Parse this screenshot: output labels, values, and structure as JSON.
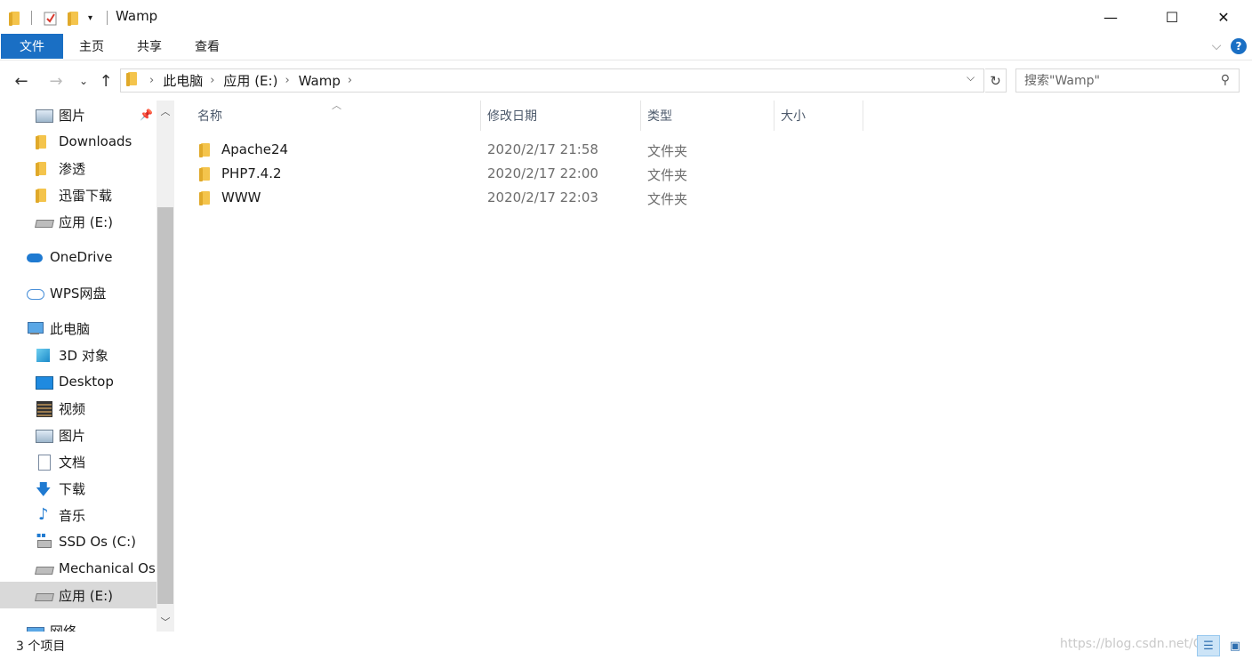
{
  "window": {
    "title": "Wamp",
    "minimize": "—",
    "maximize": "☐",
    "close": "✕"
  },
  "ribbon": {
    "tabs": [
      "文件",
      "主页",
      "共享",
      "查看"
    ],
    "collapse": "⌵",
    "help": "?"
  },
  "nav_buttons": {
    "back": "←",
    "forward": "→",
    "recent": "⌄",
    "up": "↑"
  },
  "address": {
    "crumbs": [
      "此电脑",
      "应用 (E:)",
      "Wamp"
    ],
    "separator": "›"
  },
  "search": {
    "placeholder": "搜索\"Wamp\""
  },
  "sidebar": {
    "items": [
      {
        "label": "图片",
        "icon": "pictures-icon"
      },
      {
        "label": "Downloads",
        "icon": "folder-icon"
      },
      {
        "label": "渗透",
        "icon": "folder-icon"
      },
      {
        "label": "迅雷下载",
        "icon": "folder-icon"
      },
      {
        "label": "应用 (E:)",
        "icon": "drive-icon"
      },
      {
        "label": "OneDrive",
        "icon": "onedrive-icon"
      },
      {
        "label": "WPS网盘",
        "icon": "cloud-icon"
      },
      {
        "label": "此电脑",
        "icon": "this-pc-icon"
      },
      {
        "label": "3D 对象",
        "icon": "3d-objects-icon"
      },
      {
        "label": "Desktop",
        "icon": "desktop-icon"
      },
      {
        "label": "视频",
        "icon": "videos-icon"
      },
      {
        "label": "图片",
        "icon": "pictures-icon"
      },
      {
        "label": "文档",
        "icon": "documents-icon"
      },
      {
        "label": "下载",
        "icon": "download-icon"
      },
      {
        "label": "音乐",
        "icon": "music-icon"
      },
      {
        "label": "SSD Os (C:)",
        "icon": "windows-drive-icon"
      },
      {
        "label": "Mechanical Os",
        "icon": "drive-icon"
      },
      {
        "label": "应用 (E:)",
        "icon": "drive-icon"
      },
      {
        "label": "网络",
        "icon": "network-icon"
      }
    ],
    "selected": "应用 (E:)"
  },
  "columns": [
    "名称",
    "修改日期",
    "类型",
    "大小"
  ],
  "files": [
    {
      "name": "Apache24",
      "date": "2020/2/17 21:58",
      "type": "文件夹"
    },
    {
      "name": "PHP7.4.2",
      "date": "2020/2/17 22:00",
      "type": "文件夹"
    },
    {
      "name": "WWW",
      "date": "2020/2/17 22:03",
      "type": "文件夹"
    }
  ],
  "status": {
    "count": "3 个项目"
  },
  "watermark": "https://blog.csdn.net/Q..."
}
